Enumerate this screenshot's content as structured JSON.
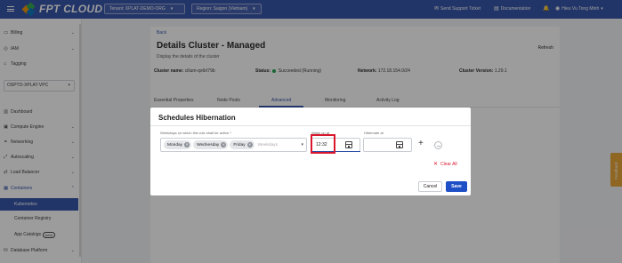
{
  "header": {
    "brand": "FPT CLOUD",
    "tenant": "Tenant: XPLAT-DEMO-ORG",
    "region": "Region: Saigon (Vietnam)",
    "support": "Send Support Ticket",
    "documentation": "Documentation",
    "user": "Hieu Vu Tong Minh"
  },
  "sidebar": {
    "billing": "Billing",
    "iam": "IAM",
    "tagging": "Tagging",
    "vpc": "OSPTO-XPLAT-VPC",
    "dashboard": "Dashboard",
    "compute": "Compute Engine",
    "networking": "Networking",
    "autoscaling": "Autoscaling",
    "load_balancer": "Load Balancer",
    "containers": "Containers",
    "kubernetes": "Kubernetes",
    "registry": "Container Registry",
    "app_catalogs": "App Catalogs",
    "beta": "beta",
    "database": "Database Platform"
  },
  "page": {
    "back": "Back",
    "title": "Details Cluster - Managed",
    "subtitle": "Display the details of the cluster",
    "refresh": "Refresh",
    "cluster_name_label": "Cluster name:",
    "cluster_name": "cilium-qx6rt79b",
    "status_label": "Status:",
    "status": "Succeeded (Running)",
    "network_label": "Network:",
    "network": "172.18.154.0/24",
    "version_label": "Cluster Version:",
    "version": "1.29.1",
    "tabs": [
      "Essential Properties",
      "Node Pools",
      "Advanced",
      "Monitoring",
      "Activity Log"
    ],
    "feedback": "Feedback"
  },
  "modal": {
    "title": "Schedules Hibernation",
    "weekdays_label": "Weekdays on which this rule shall be active *",
    "days": [
      "Monday",
      "Wednesday",
      "Friday"
    ],
    "weekdays_placeholder": "Weekdays",
    "wake_label": "Wake up at",
    "wake_value": "12:32",
    "hibernate_label": "Hibernate at",
    "hibernate_value": "",
    "clear_all": "Clear All",
    "cancel": "Cancel",
    "save": "Save"
  },
  "colors": {
    "brand_blue": "#2d4ea6",
    "primary_button": "#1f4fc7",
    "success": "#1ea34a",
    "danger": "#d9182e",
    "feedback": "#e8a22e"
  }
}
